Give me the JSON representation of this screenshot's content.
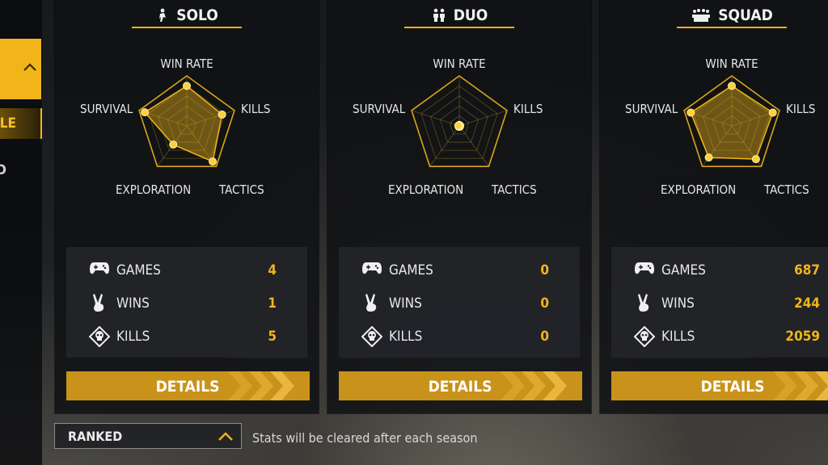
{
  "sidebar": {
    "selected_label": "ALE",
    "other_label": "D",
    "collapse_icon": "chevron-up-icon"
  },
  "accent": "#f1b519",
  "radar_labels": {
    "win_rate": "WIN RATE",
    "kills": "KILLS",
    "tactics": "TACTICS",
    "exploration": "EXPLORATION",
    "survival": "SURVIVAL"
  },
  "panels": [
    {
      "mode": "SOLO",
      "icon": "solo-player-icon",
      "radar": {
        "win_rate": 0.8,
        "kills": 0.74,
        "tactics": 0.88,
        "exploration": 0.46,
        "survival": 0.88
      },
      "stats": {
        "games_label": "GAMES",
        "games": "4",
        "wins_label": "WINS",
        "wins": "1",
        "kills_label": "KILLS",
        "kills": "5"
      },
      "details_label": "DETAILS"
    },
    {
      "mode": "DUO",
      "icon": "duo-players-icon",
      "radar": {
        "win_rate": 0.02,
        "kills": 0.02,
        "tactics": 0.02,
        "exploration": 0.02,
        "survival": 0.02
      },
      "stats": {
        "games_label": "GAMES",
        "games": "0",
        "wins_label": "WINS",
        "wins": "0",
        "kills_label": "KILLS",
        "kills": "0"
      },
      "details_label": "DETAILS"
    },
    {
      "mode": "SQUAD",
      "icon": "squad-players-icon",
      "radar": {
        "win_rate": 0.8,
        "kills": 0.86,
        "tactics": 0.82,
        "exploration": 0.78,
        "survival": 0.86
      },
      "stats": {
        "games_label": "GAMES",
        "games": "687",
        "wins_label": "WINS",
        "wins": "244",
        "kills_label": "KILLS",
        "kills": "2059"
      },
      "details_label": "DETAILS"
    }
  ],
  "season_filter": {
    "label": "RANKED",
    "icon": "chevron-up-icon"
  },
  "season_note": "Stats will be cleared after each season"
}
